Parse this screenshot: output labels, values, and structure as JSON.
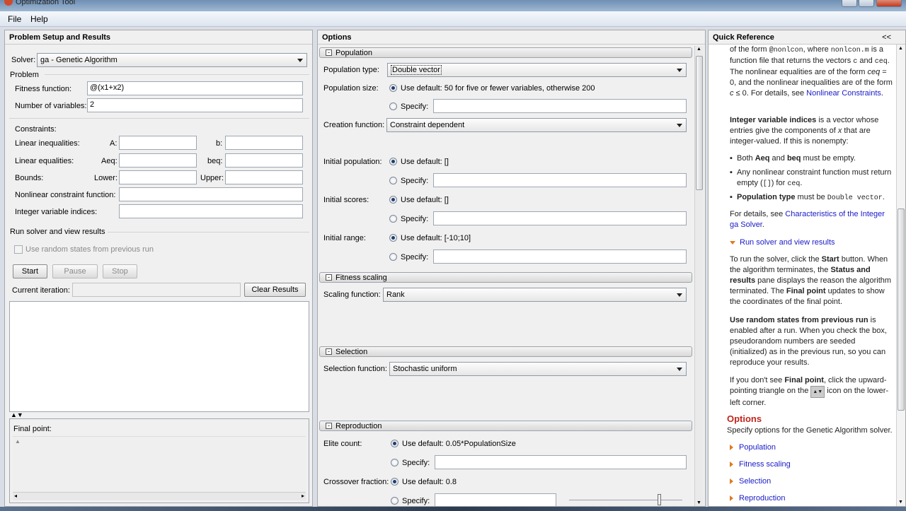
{
  "window": {
    "title": "Optimization Tool"
  },
  "menu": {
    "file": "File",
    "help": "Help"
  },
  "problem": {
    "header": "Problem Setup and Results",
    "solver_label": "Solver:",
    "solver_value": "ga - Genetic Algorithm",
    "problem_group": "Problem",
    "fitness_label": "Fitness function:",
    "fitness_value": "@(x1+x2)",
    "nvars_label": "Number of variables:",
    "nvars_value": "2",
    "constraints_label": "Constraints:",
    "lin_ineq_label": "Linear inequalities:",
    "a_label": "A:",
    "b_label": "b:",
    "lin_eq_label": "Linear equalities:",
    "aeq_label": "Aeq:",
    "beq_label": "beq:",
    "bounds_label": "Bounds:",
    "lower_label": "Lower:",
    "upper_label": "Upper:",
    "nonlin_label": "Nonlinear constraint function:",
    "intvar_label": "Integer variable indices:",
    "run_group": "Run solver and view results",
    "random_states": "Use random states from previous run",
    "start": "Start",
    "pause": "Pause",
    "stop": "Stop",
    "current_iter_label": "Current iteration:",
    "clear_results": "Clear Results",
    "final_point_label": "Final point:"
  },
  "options": {
    "header": "Options",
    "population": {
      "title": "Population",
      "type_label": "Population type:",
      "type_value": "Double vector",
      "size_label": "Population size:",
      "size_default": "Use default: 50 for five or fewer variables, otherwise 200",
      "specify": "Specify:",
      "creation_label": "Creation function:",
      "creation_value": "Constraint dependent",
      "init_pop_label": "Initial population:",
      "init_pop_default": "Use default: []",
      "init_scores_label": "Initial scores:",
      "init_scores_default": "Use default: []",
      "init_range_label": "Initial range:",
      "init_range_default": "Use default: [-10;10]"
    },
    "fitness_scaling": {
      "title": "Fitness scaling",
      "label": "Scaling function:",
      "value": "Rank"
    },
    "selection": {
      "title": "Selection",
      "label": "Selection function:",
      "value": "Stochastic uniform"
    },
    "reproduction": {
      "title": "Reproduction",
      "elite_label": "Elite count:",
      "elite_default": "Use default: 0.05*PopulationSize",
      "crossover_label": "Crossover fraction:",
      "crossover_default": "Use default: 0.8",
      "specify": "Specify:"
    }
  },
  "quickref": {
    "header": "Quick Reference",
    "collapse": "<<",
    "p1a": "of the form ",
    "p1b": "@nonlcon",
    "p1c": ", where ",
    "p1d": "nonlcon.m",
    "p1e": " is a function file that returns the vectors ",
    "p1f": "c",
    "p1g": " and ",
    "p1h": "ceq",
    "p1i": ". The nonlinear equalities are of the form ",
    "p1j": "ceq",
    "p1k": " = 0, and the nonlinear inequalities are of the form ",
    "p1l": "c",
    "p1m": " ≤ 0. For details, see ",
    "p1link": "Nonlinear Constraints",
    "p2a": "Integer variable indices",
    "p2b": " is a vector whose entries give the components of ",
    "p2c": "x",
    "p2d": " that are integer-valued. If this is nonempty:",
    "b1a": "Both ",
    "b1b": "Aeq",
    "b1c": " and ",
    "b1d": "beq",
    "b1e": " must be empty.",
    "b2a": "Any nonlinear constraint function must return empty (",
    "b2b": "[]",
    "b2c": ") for ",
    "b2d": "ceq",
    "b3a": "Population type",
    "b3b": " must be ",
    "b3c": "Double vector",
    "p3a": "For details, see ",
    "p3link": "Characteristics of the Integer ga Solver",
    "run_link": "Run solver and view results",
    "p4a": "To run the solver, click the ",
    "p4b": "Start",
    "p4c": " button. When the algorithm terminates, the ",
    "p4d": "Status and results",
    "p4e": " pane displays the reason the algorithm terminated. The ",
    "p4f": "Final point",
    "p4g": " updates to show the coordinates of the final point.",
    "p5a": "Use random states from previous run",
    "p5b": " is enabled after a run. When you check the box, pseudorandom numbers are seeded (initialized) as in the previous run, so you can reproduce your results.",
    "p6a": "If you don't see ",
    "p6b": "Final point",
    "p6c": ", click the upward-pointing triangle on the ",
    "p6d": " icon on the lower-left corner.",
    "options_title": "Options",
    "options_desc": "Specify options for the Genetic Algorithm solver.",
    "links": [
      "Population",
      "Fitness scaling",
      "Selection",
      "Reproduction"
    ]
  }
}
